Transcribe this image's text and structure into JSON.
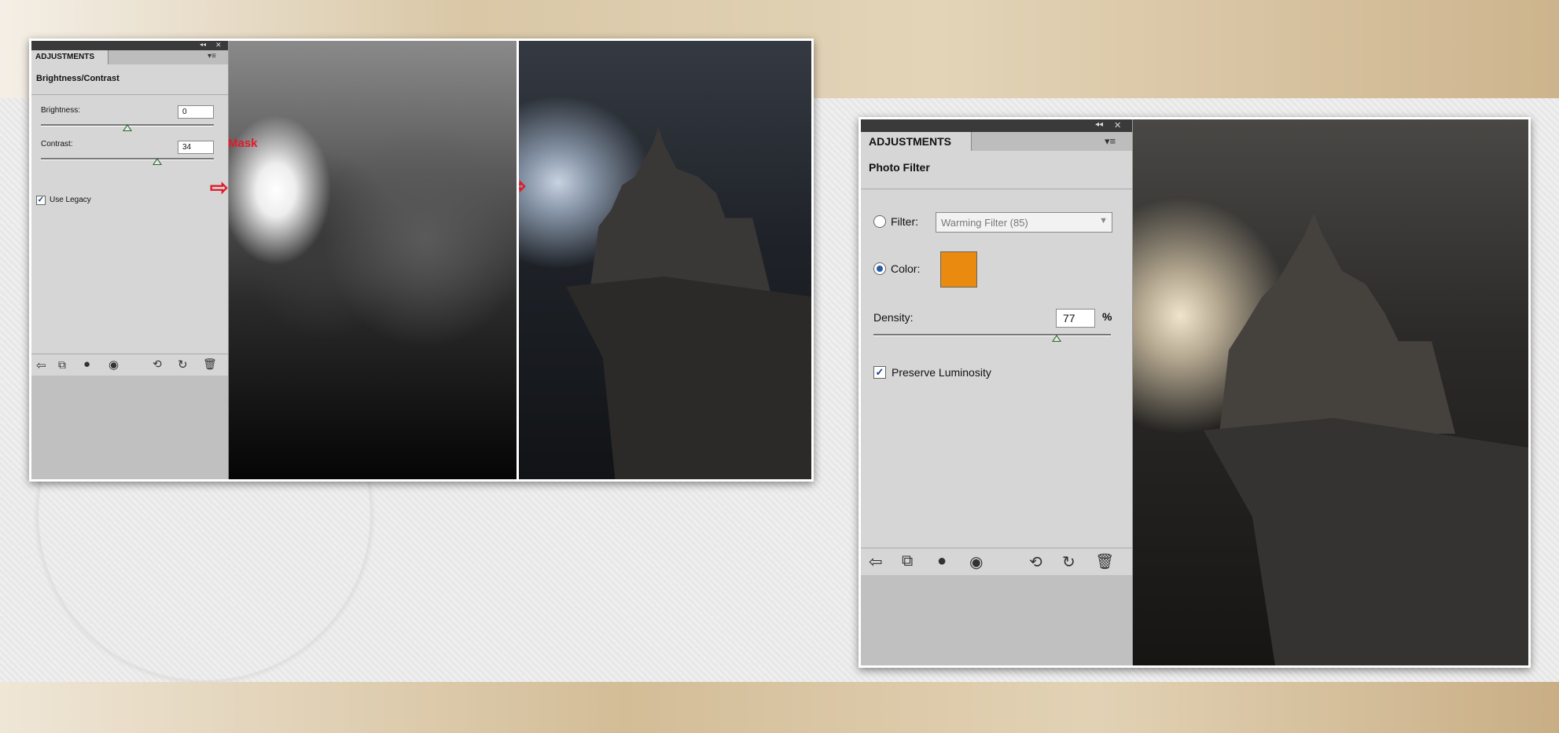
{
  "left_panel": {
    "tab_label": "ADJUSTMENTS",
    "collapse_glyph": "◂◂",
    "close_glyph": "✕",
    "menu_glyph": "▾≡",
    "title": "Brightness/Contrast",
    "brightness_label": "Brightness:",
    "brightness_value": "0",
    "contrast_label": "Contrast:",
    "contrast_value": "34",
    "legacy_label": "Use Legacy",
    "legacy_checked": true,
    "footer_icons": [
      "back-arrow-icon",
      "clip-icon",
      "visibility-eye-icon",
      "view-icon",
      "previous-state-icon",
      "reset-icon",
      "trash-icon"
    ]
  },
  "mask_label": "Mask",
  "right_panel": {
    "tab_label": "ADJUSTMENTS",
    "collapse_glyph": "◂◂",
    "close_glyph": "✕",
    "menu_glyph": "▾≡",
    "title": "Photo Filter",
    "filter_label": "Filter:",
    "filter_value": "Warming Filter (85)",
    "color_label": "Color:",
    "color_swatch": "#ea8a0e",
    "density_label": "Density:",
    "density_value": "77",
    "density_unit": "%",
    "density_fraction": 0.77,
    "preserve_label": "Preserve Luminosity",
    "preserve_checked": true
  },
  "colors": {
    "arrow_red": "#e11a2a",
    "thumb_green": "#2c6c2c",
    "radio_blue": "#2a5ba8"
  }
}
